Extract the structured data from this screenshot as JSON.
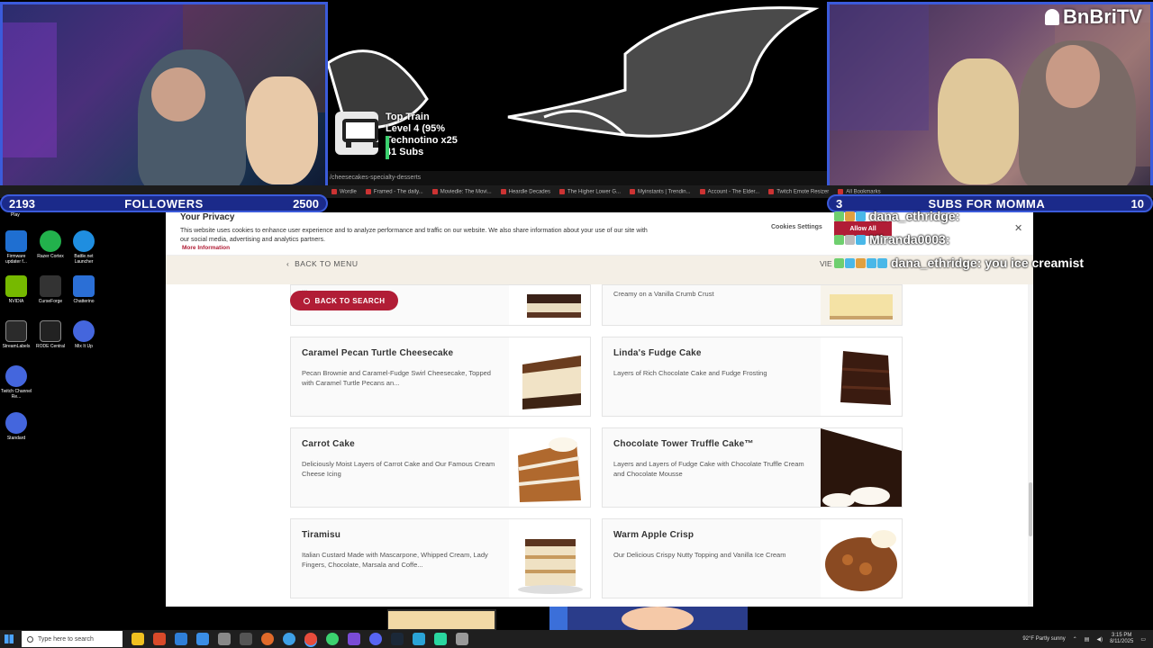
{
  "overlay": {
    "train": {
      "line1": "Top Train",
      "line2": "Level 4 (95%",
      "line3": "Technotino x25",
      "line4": "41 Subs"
    },
    "brand": "BnBriTV",
    "url_fragment": "/cheesecakes-specialty-desserts",
    "followers": {
      "current": "2193",
      "label": "FOLLOWERS",
      "goal": "2500"
    },
    "subs": {
      "current": "3",
      "label": "SUBS FOR MOMMA",
      "goal": "10"
    }
  },
  "bookmarks": [
    "Wordle",
    "Framed - The daily...",
    "Moviedle: The Movi...",
    "Heardle Decades",
    "The Higher Lower G...",
    "Myinstants | Trendin...",
    "Account - The Elder...",
    "Twitch Emote Resizer",
    "All Bookmarks"
  ],
  "desktop": {
    "top_label": "Play",
    "icons": [
      {
        "label": "Firmware updater f...",
        "color": "#1f6fd1"
      },
      {
        "label": "Razer Cortex",
        "color": "#22b14c"
      },
      {
        "label": "Battle.net Launcher",
        "color": "#1f8ee0"
      },
      {
        "label": "NVIDIA",
        "color": "#76b900"
      },
      {
        "label": "CurseForge",
        "color": "#333333"
      },
      {
        "label": "Chatterino",
        "color": "#2b6fd6"
      },
      {
        "label": "StreamLabels",
        "color": "#2b2b2b"
      },
      {
        "label": "RODE Central",
        "color": "#222222"
      },
      {
        "label": "Mix It Up",
        "color": "#4466dd"
      },
      {
        "label": "Twitch Channel Re...",
        "color": "#4466dd"
      },
      {
        "label": "Standard",
        "color": "#4466dd"
      }
    ]
  },
  "privacy": {
    "title": "Your Privacy",
    "text": "This website uses cookies to enhance user experience and to analyze performance and traffic on our website. We also share information about your use of our site with our social media, advertising and analytics partners.",
    "more": "More Information",
    "settings": "Cookies Settings",
    "allow": "Allow All"
  },
  "nav": {
    "back_menu": "BACK TO MENU",
    "view": "VIE",
    "back_search": "BACK TO SEARCH"
  },
  "menu_items": [
    {
      "title": "",
      "desc": "...",
      "image": "cheesecake-layered"
    },
    {
      "title": "",
      "desc": "Creamy on a Vanilla Crumb Crust",
      "image": "cheesecake-plain"
    },
    {
      "title": "Caramel Pecan Turtle Cheesecake",
      "desc": "Pecan Brownie and Caramel-Fudge Swirl Cheesecake, Topped with Caramel Turtle Pecans an...",
      "image": "turtle-cheesecake"
    },
    {
      "title": "Linda's Fudge Cake",
      "desc": "Layers of Rich Chocolate Cake and Fudge Frosting",
      "image": "fudge-cake"
    },
    {
      "title": "Carrot Cake",
      "desc": "Deliciously Moist Layers of Carrot Cake and Our Famous Cream Cheese Icing",
      "image": "carrot-cake"
    },
    {
      "title": "Chocolate Tower Truffle Cake™",
      "desc": "Layers and Layers of Fudge Cake with Chocolate Truffle Cream and Chocolate Mousse",
      "image": "truffle-cake"
    },
    {
      "title": "Tiramisu",
      "desc": "Italian Custard Made with Mascarpone, Whipped Cream, Lady Fingers, Chocolate, Marsala and Coffe...",
      "image": "tiramisu"
    },
    {
      "title": "Warm Apple Crisp",
      "desc": "Our Delicious Crispy Nutty Topping and Vanilla Ice Cream",
      "image": "apple-crisp"
    }
  ],
  "chat": [
    {
      "name": "dana_ethridge:",
      "msg": ""
    },
    {
      "name": "Miranda0003:",
      "msg": ""
    },
    {
      "name": "dana_ethridge:",
      "msg": "you ice creamist"
    }
  ],
  "taskbar": {
    "search_placeholder": "Type here to search",
    "weather": "92°F  Partly sunny",
    "time": "3:15 PM",
    "date": "8/11/2025"
  }
}
